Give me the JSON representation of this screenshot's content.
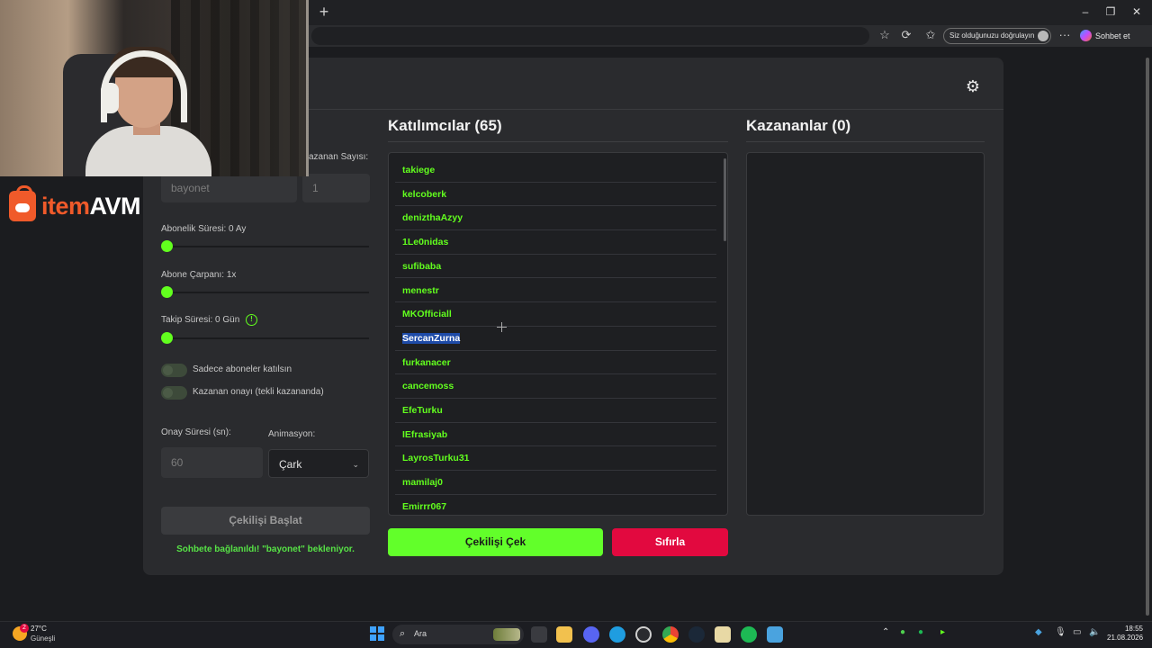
{
  "browser": {
    "new_tab": "+",
    "window_controls": {
      "minimize": "–",
      "restore": "❐",
      "close": "✕"
    },
    "verify_label": "Siz olduğunuzu doğrulayın",
    "chat_label": "Sohbet et",
    "menu": "···"
  },
  "overlay": {
    "brand_part1": "item",
    "brand_part2": "AVM"
  },
  "settings": {
    "keyword_value": "bayonet",
    "winner_count_label": "azanan Sayısı:",
    "winner_count_value": "1",
    "sub_duration_label": "Abonelik Süresi: 0 Ay",
    "sub_multiplier_label": "Abone Çarpanı: 1x",
    "follow_duration_label": "Takip Süresi:  0  Gün",
    "info_icon": "!",
    "subs_only_label": "Sadece aboneler katılsın",
    "winner_confirm_label": "Kazanan onayı (tekli kazananda)",
    "confirm_time_label": "Onay Süresi (sn):",
    "confirm_time_value": "60",
    "animation_label": "Animasyon:",
    "animation_value": "Çark",
    "start_button": "Çekilişi Başlat",
    "status_text": "Sohbete bağlanıldı! \"bayonet\" bekleniyor."
  },
  "participants": {
    "title": "Katılımcılar (65)",
    "items": [
      "takiege",
      "kelcoberk",
      "denizthaAzyy",
      "1Le0nidas",
      "sufibaba",
      "menestr",
      "MKOfficiall",
      "SercanZurna",
      "furkanacer",
      "cancemoss",
      "EfeTurku",
      "IEfrasiyab",
      "LayrosTurku31",
      "mamilaj0",
      "Emirrr067"
    ],
    "selected_index": 7
  },
  "winners": {
    "title": "Kazananlar (0)"
  },
  "actions": {
    "draw_button": "Çekilişi Çek",
    "reset_button": "Sıfırla"
  },
  "taskbar": {
    "weather_badge": "2",
    "temperature": "27°C",
    "weather": "Güneşli",
    "search_placeholder": "Ara",
    "time": "18:55",
    "date": "21.08.2026"
  },
  "colors": {
    "accent_green": "#62ff1e",
    "reset_red": "#e2093f",
    "brand_orange": "#f05a2a",
    "panel_bg": "#2a2b2e"
  }
}
